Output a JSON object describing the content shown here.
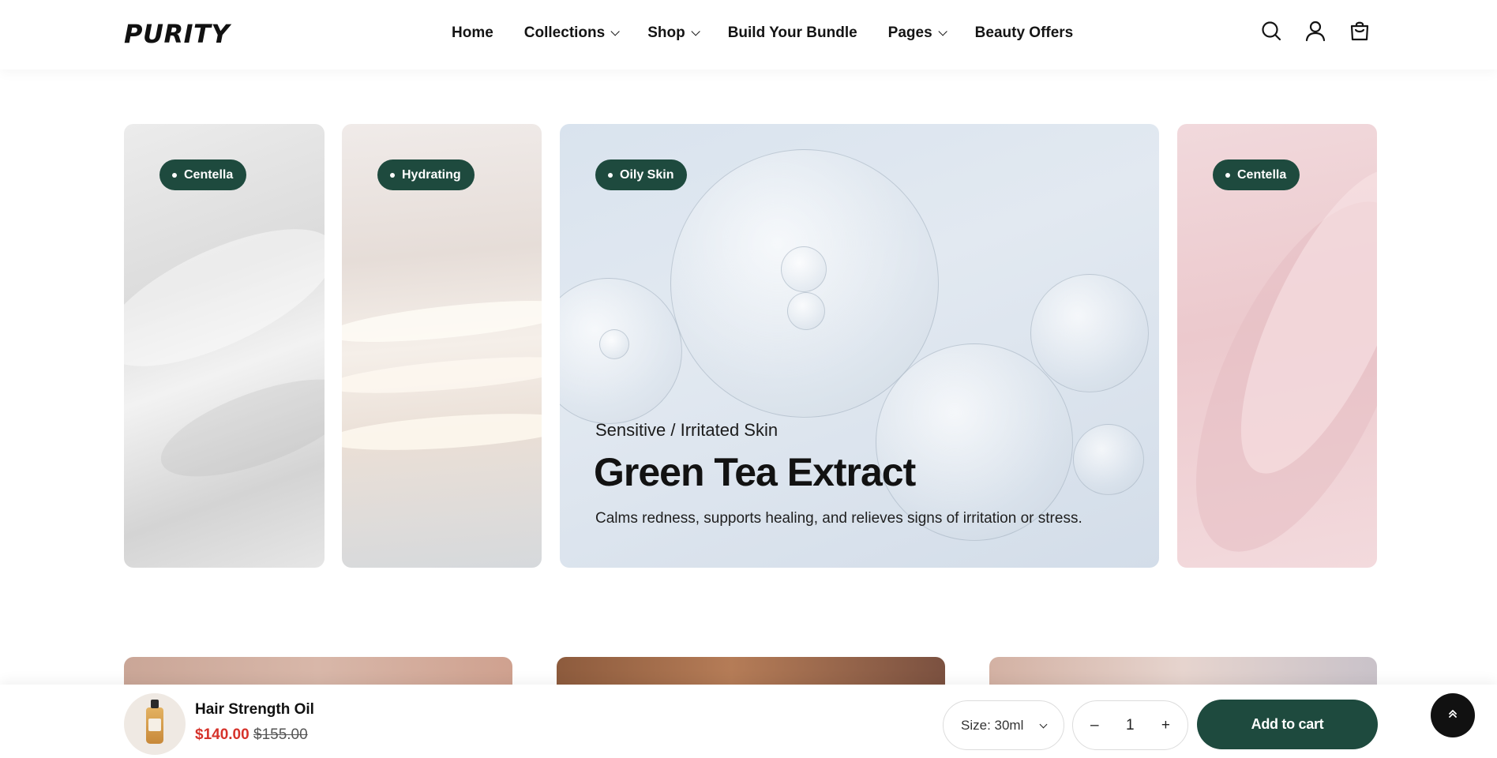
{
  "header": {
    "logo": "PURITY",
    "nav": [
      {
        "label": "Home",
        "has_dropdown": false
      },
      {
        "label": "Collections",
        "has_dropdown": true
      },
      {
        "label": "Shop",
        "has_dropdown": true
      },
      {
        "label": "Build Your Bundle",
        "has_dropdown": false
      },
      {
        "label": "Pages",
        "has_dropdown": true
      },
      {
        "label": "Beauty Offers",
        "has_dropdown": false
      }
    ],
    "icons": [
      "search-icon",
      "account-icon",
      "cart-icon"
    ]
  },
  "slider": {
    "cards": [
      {
        "badge": "Centella"
      },
      {
        "badge": "Hydrating"
      },
      {
        "badge": "Oily Skin",
        "subtitle": "Sensitive / Irritated Skin",
        "title": "Green Tea Extract",
        "description": "Calms redness, supports healing, and relieves signs of irritation or stress."
      },
      {
        "badge": "Centella"
      }
    ]
  },
  "sticky_cart": {
    "product_name": "Hair Strength Oil",
    "price": "$140.00",
    "compare_price": "$155.00",
    "size_label": "Size: 30ml",
    "qty_minus": "–",
    "quantity": "1",
    "qty_plus": "+",
    "add_to_cart": "Add to cart"
  },
  "colors": {
    "accent": "#1e4a3e",
    "sale_price": "#d6322a"
  }
}
